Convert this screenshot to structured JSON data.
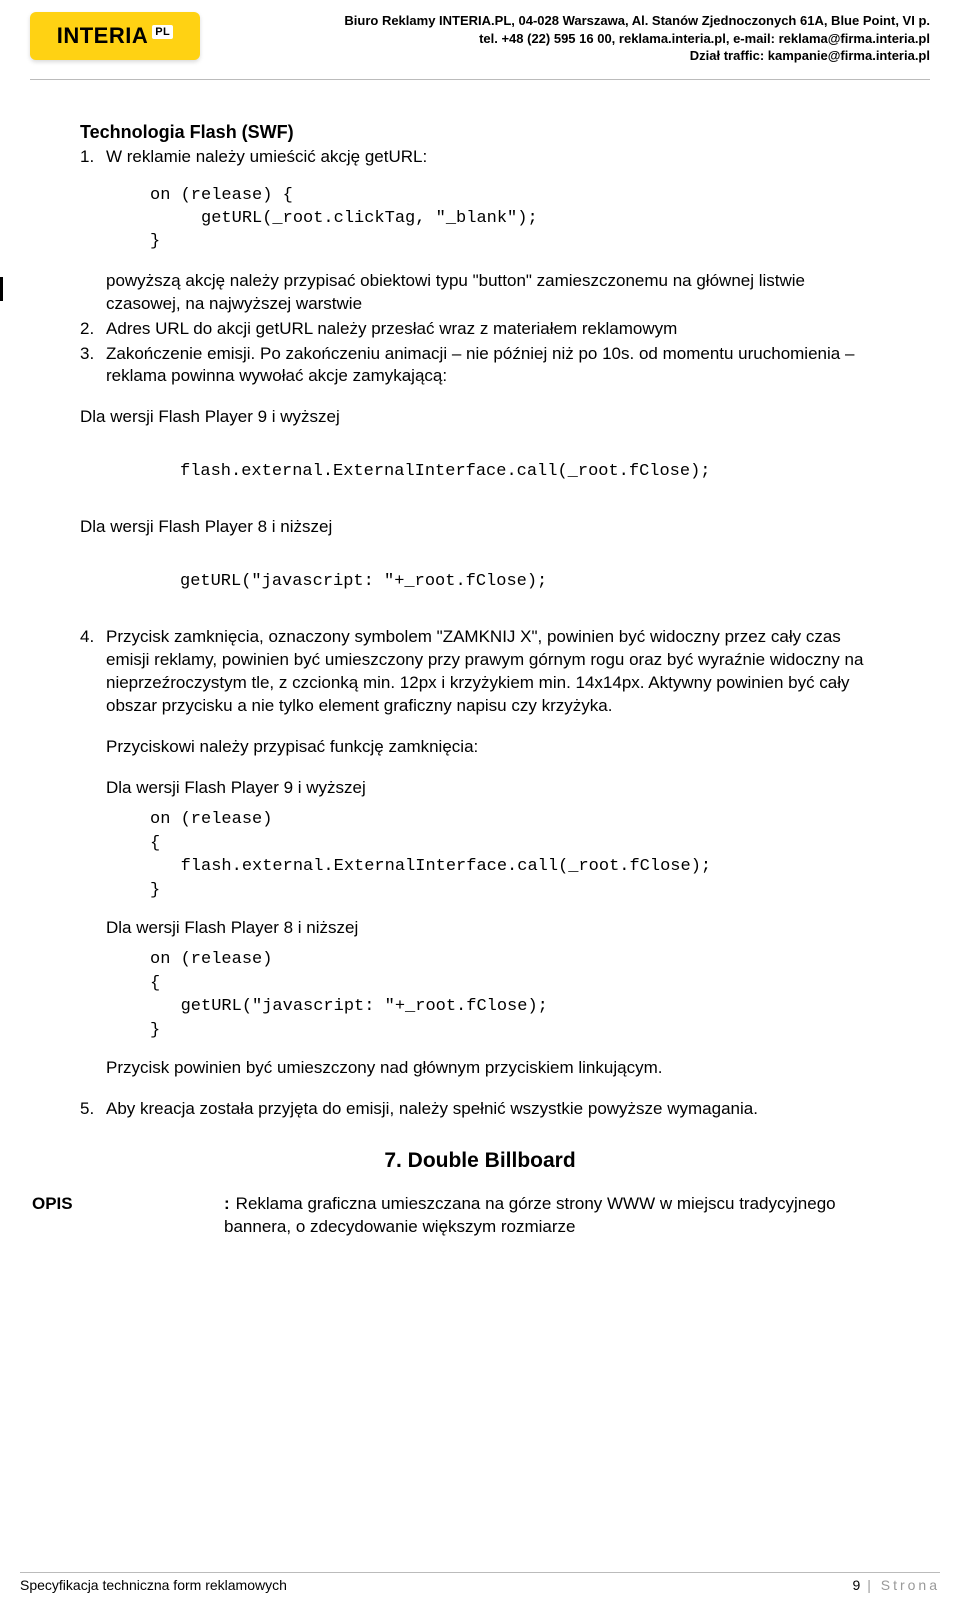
{
  "header": {
    "logo_main": "INTERIA",
    "logo_suffix": "PL",
    "line1": "Biuro Reklamy INTERIA.PL, 04-028 Warszawa, Al. Stanów Zjednoczonych 61A, Blue Point, VI p.",
    "line2": "tel. +48 (22) 595 16 00, reklama.interia.pl, e-mail: reklama@firma.interia.pl",
    "line3": "Dział traffic: kampanie@firma.interia.pl"
  },
  "section": {
    "title": "Technologia Flash (SWF)",
    "item1_num": "1.",
    "item1_text": "W reklamie należy umieścić akcję getURL:",
    "code1": "on (release) {\n     getURL(_root.clickTag, \"_blank\");\n}",
    "after1_a": "powyższą akcję należy przypisać obiektowi typu \"button\" zamieszczonemu na głównej listwie czasowej, na najwyższej warstwie",
    "item2_num": "2.",
    "item2_text": "Adres URL do akcji getURL należy przesłać wraz z materiałem reklamowym",
    "item3_num": "3.",
    "item3_text": "Zakończenie emisji. Po zakończeniu animacji – nie później niż po 10s. od momentu uruchomienia – reklama powinna wywołać akcje zamykającą:",
    "fp9_label": "Dla wersji Flash Player 9 i wyższej",
    "code_fp9": "flash.external.ExternalInterface.call(_root.fClose);",
    "fp8_label": "Dla wersji Flash Player 8 i niższej",
    "code_fp8": "getURL(\"javascript: \"+_root.fClose);",
    "item4_num": "4.",
    "item4_text": "Przycisk zamknięcia, oznaczony symbolem \"ZAMKNIJ X\", powinien być widoczny przez cały czas emisji reklamy, powinien być umieszczony przy prawym górnym rogu oraz być wyraźnie widoczny na nieprzeźroczystym tle, z czcionką min. 12px i krzyżykiem min. 14x14px. Aktywny powinien być cały obszar przycisku a nie tylko element graficzny napisu czy krzyżyka.",
    "item4_sub": "Przyciskowi należy przypisać funkcję zamknięcia:",
    "code_fp9b": "on (release)\n{\n   flash.external.ExternalInterface.call(_root.fClose);\n}",
    "code_fp8b": "on (release)\n{\n   getURL(\"javascript: \"+_root.fClose);\n}",
    "item4_end": "Przycisk powinien być umieszczony nad głównym przyciskiem linkującym.",
    "item5_num": "5.",
    "item5_text": "Aby kreacja została przyjęta do emisji, należy spełnić wszystkie powyższe wymagania."
  },
  "section7": {
    "heading": "7. Double Billboard",
    "opis_label": "OPIS",
    "opis_colon": ":",
    "opis_text": "Reklama graficzna umieszczana na górze strony WWW w miejscu tradycyjnego bannera, o zdecydowanie większym rozmiarze"
  },
  "footer": {
    "left": "Specyfikacja techniczna form reklamowych",
    "page_num": "9",
    "page_sep": " | ",
    "page_word": "Strona"
  }
}
